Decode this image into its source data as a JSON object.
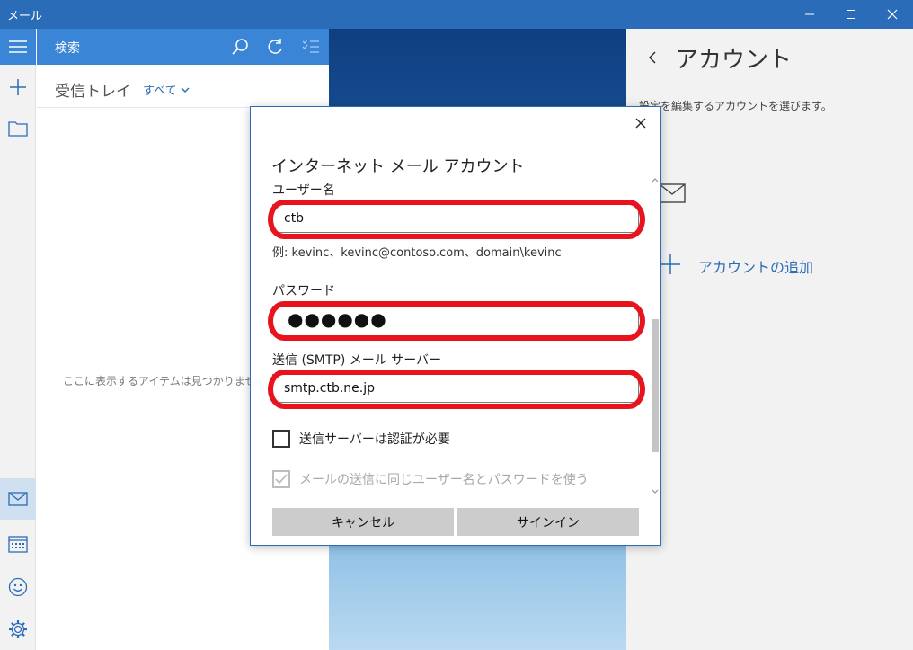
{
  "window": {
    "title": "メール"
  },
  "list": {
    "search_placeholder": "検索",
    "folder": "受信トレイ",
    "filter": "すべて",
    "empty_message": "ここに表示するアイテムは見つかりません。"
  },
  "accounts": {
    "title": "アカウント",
    "description": "設定を編集するアカウントを選びます。",
    "add_label": "アカウントの追加"
  },
  "dialog": {
    "title": "インターネット メール アカウント",
    "username": {
      "label": "ユーザー名",
      "value": "ctb"
    },
    "hint": "例: kevinc、kevinc@contoso.com、domain\\kevinc",
    "password": {
      "label": "パスワード",
      "value": "●●●●●●"
    },
    "smtp": {
      "label": "送信 (SMTP) メール サーバー",
      "value": "smtp.ctb.ne.jp"
    },
    "auth_checkbox": {
      "label": "送信サーバーは認証が必要",
      "checked": false
    },
    "same_cred_checkbox": {
      "label": "メールの送信に同じユーザー名とパスワードを使う",
      "checked": true,
      "disabled": true
    },
    "cancel_label": "キャンセル",
    "signin_label": "サインイン"
  },
  "colors": {
    "accent": "#2b6cb8",
    "searchbar": "#3b85d6",
    "highlight": "#e8131c"
  },
  "icons": [
    "hamburger-icon",
    "plus-icon",
    "folder-icon",
    "mail-icon",
    "calendar-icon",
    "smiley-icon",
    "gear-icon",
    "search-icon",
    "sync-icon",
    "select-icon",
    "back-icon",
    "close-icon"
  ]
}
